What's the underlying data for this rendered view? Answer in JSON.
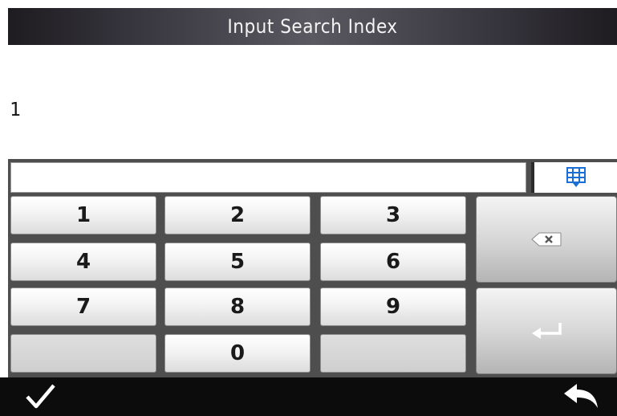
{
  "header": {
    "title": "Input Search Index"
  },
  "input": {
    "value": "1"
  },
  "keypad": {
    "rows": [
      [
        "1",
        "2",
        "3"
      ],
      [
        "4",
        "5",
        "6"
      ],
      [
        "7",
        "8",
        "9"
      ],
      [
        "",
        "0",
        ""
      ]
    ],
    "special_keys": [
      "backspace-icon",
      "enter-icon",
      "keyboard-grid-icon"
    ]
  },
  "footer": {
    "icons": [
      "checkmark-icon",
      "back-arrow-icon"
    ]
  },
  "colors": {
    "accent": "#1a6fd6",
    "title_bar": "#3a383e",
    "keyboard_bg": "#4e4e4e",
    "footer_bg": "#0c0c0c"
  }
}
